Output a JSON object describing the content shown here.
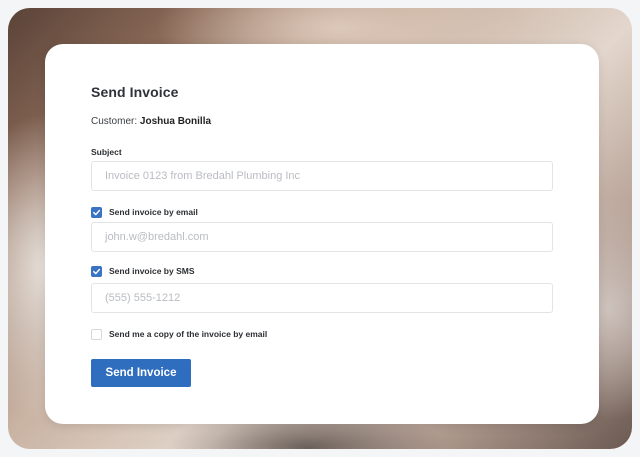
{
  "dialog": {
    "title": "Send Invoice",
    "customer_label": "Customer:",
    "customer_name": "Joshua Bonilla",
    "subject_label": "Subject",
    "subject_placeholder": "Invoice 0123 from Bredahl Plumbing Inc",
    "email_option": {
      "label": "Send invoice by email",
      "checked": true
    },
    "email_placeholder": "john.w@bredahl.com",
    "sms_option": {
      "label": "Send invoice by SMS",
      "checked": true
    },
    "sms_placeholder": "(555) 555-1212",
    "copy_option": {
      "label": "Send me a copy of the invoice by email",
      "checked": false
    },
    "submit_label": "Send Invoice"
  },
  "colors": {
    "accent": "#2f6dbe",
    "checkbox_checked": "#3a72c4"
  },
  "icons": {
    "checkmark": "check-icon"
  }
}
